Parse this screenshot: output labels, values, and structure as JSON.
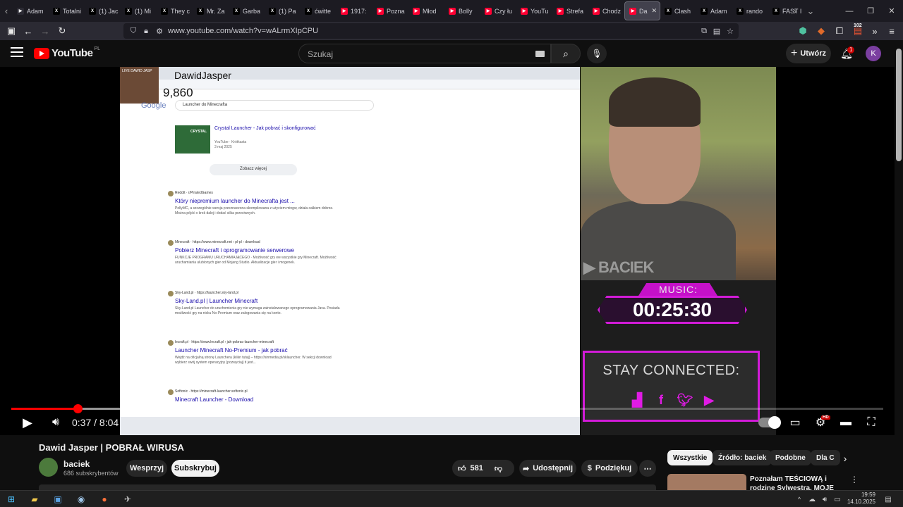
{
  "browser": {
    "tabs": [
      {
        "label": "Adam",
        "icon": "youtube-icon",
        "color": "#2b2a33"
      },
      {
        "label": "Totalni",
        "icon": "x-icon",
        "color": "#000000"
      },
      {
        "label": "(1) Jac",
        "icon": "x-icon",
        "color": "#000000"
      },
      {
        "label": "(1) Mi",
        "icon": "x-icon",
        "color": "#000000"
      },
      {
        "label": "They c",
        "icon": "x-icon",
        "color": "#000000"
      },
      {
        "label": "Mr. Za",
        "icon": "x-icon",
        "color": "#000000"
      },
      {
        "label": "Garba",
        "icon": "x-icon",
        "color": "#000000"
      },
      {
        "label": "(1) Pa",
        "icon": "x-icon",
        "color": "#000000"
      },
      {
        "label": "ćwitte",
        "icon": "x-icon",
        "color": "#000000"
      },
      {
        "label": "1917:",
        "icon": "youtube-icon",
        "color": "#ff0033"
      },
      {
        "label": "Pozna",
        "icon": "youtube-icon",
        "color": "#ff0033"
      },
      {
        "label": "Młod",
        "icon": "youtube-icon",
        "color": "#ff0033"
      },
      {
        "label": "Bolly",
        "icon": "youtube-icon",
        "color": "#ff0033"
      },
      {
        "label": "Czy łu",
        "icon": "youtube-icon",
        "color": "#ff0033"
      },
      {
        "label": "YouTu",
        "icon": "youtube-icon",
        "color": "#ff0033"
      },
      {
        "label": "Strefa",
        "icon": "youtube-icon",
        "color": "#ff0033"
      },
      {
        "label": "Chodz",
        "icon": "youtube-icon",
        "color": "#ff0033"
      },
      {
        "label": "Da",
        "icon": "youtube-icon",
        "color": "#ff0033",
        "active": true
      },
      {
        "label": "Clash",
        "icon": "x-icon",
        "color": "#000000"
      },
      {
        "label": "Adam",
        "icon": "x-icon",
        "color": "#000000"
      },
      {
        "label": "rando",
        "icon": "x-icon",
        "color": "#000000"
      },
      {
        "label": "FAST I",
        "icon": "x-icon",
        "color": "#000000"
      }
    ],
    "url": "www.youtube.com/watch?v=wALrmXIpCPU",
    "extension_badge": "102"
  },
  "youtube": {
    "logo_text": "YouTube",
    "country_code": "PL",
    "search_placeholder": "Szukaj",
    "create_label": "Utwórz",
    "notification_count": "1",
    "avatar_letter": "K"
  },
  "stream": {
    "streamer_name": "DawidJasper",
    "viewer_count": "9,860",
    "live_tag": "LIVE DAWID JASP",
    "google_logo": "Google",
    "search_query": "Launcher do Minecrafta",
    "video_result": {
      "title": "Crystal Launcher - Jak pobrać i skonfigurować",
      "meta": "YouTube · Krótkasta\n3 maj 2025",
      "thumb_label": "CRYSTAL"
    },
    "see_more": "Zobacz więcej",
    "results": [
      {
        "source": "Reddit · r/PiratedGames",
        "link": "Który niepremium launcher do Minecrafta jest ...",
        "desc": "PollyMC, a szczególnie wersja przeznaczona skompilowana z użyciem mingw, działa całkiem dobrze. Można pójść o krok dalej i dodać silka przeciwnych."
      },
      {
        "source": "Minecraft · https://www.minecraft.net › pl-pl › download",
        "link": "Pobierz Minecraft i oprogramowanie serwerowe",
        "desc": "FUNKCJE PROGRAMU URUCHAMIAJĄCEGO · Możliwość gry we wszystkie gry Minecraft. Możliwość uruchamiania ulubionych gier od Mojang Studio. Aktualizacje gier i mogenek."
      },
      {
        "source": "Sky-Land.pl · https://launcher.sky-land.pl",
        "link": "Sky-Land.pl | Launcher Minecraft",
        "desc": "Sky-Land.pl Launcher do uruchomienia gry nie wymaga zainstalowanego oprogramowania Java. Posiada możliwość gry na nicku No-Premium oraz zalogowania się na konto."
      },
      {
        "source": "lecraft.pl · https://www.lecraft.pl › jak-pobrac-launcher-minecraft",
        "link": "Launcher Minecraft No-Premium - jak pobrać",
        "desc": "Wejdź na oficjalną stronę Launchera (klikn tutaj) – https://sinmedia.pl/sklauncher. W sekcji download wybierz swój system operacyjny (pozwyciaj) ti jest..."
      },
      {
        "source": "Softonic · https://minecraft-launcher.softonic.pl",
        "link": "Minecraft Launcher - Download",
        "desc": ""
      }
    ],
    "cam_watermark": "BACIEK",
    "music_label": "MUSIC:",
    "music_time": "00:25:30",
    "stay_connected": "STAY CONNECTED:"
  },
  "player": {
    "current_time": "0:37",
    "duration": "8:04",
    "played_fraction": 0.076,
    "buffered_fraction": 0.17,
    "hd_label": "HD"
  },
  "video": {
    "title": "Dawid Jasper | POBRAŁ WIRUSA",
    "channel_name": "baciek",
    "subscribers": "686 subskrybentów",
    "support_label": "Wesprzyj",
    "subscribe_label": "Subskrybuj",
    "like_count": "581",
    "share_label": "Udostępnij",
    "thanks_label": "Podziękuj"
  },
  "chips": [
    "Wszystkie",
    "Źródło: baciek",
    "Podobne",
    "Dla C"
  ],
  "recommendation": {
    "title": "Poznałam TEŚCIOWĄ i rodzinę Sylwestra, MOJE URODZINY |"
  },
  "taskbar": {
    "time": "19:59",
    "date": "14.10.2025"
  }
}
